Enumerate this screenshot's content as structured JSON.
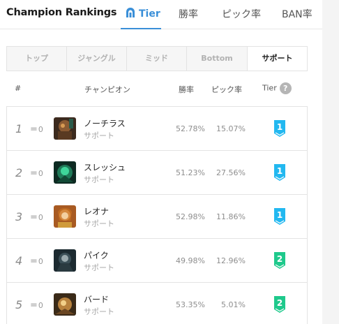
{
  "header": {
    "title": "Champion Rankings",
    "tabs": [
      {
        "label": "Tier",
        "active": true
      },
      {
        "label": "勝率",
        "active": false
      },
      {
        "label": "ピック率",
        "active": false
      },
      {
        "label": "BAN率",
        "active": false
      }
    ],
    "accent_color": "#3a8fd8"
  },
  "role_tabs": [
    "トップ",
    "ジャングル",
    "ミッド",
    "Bottom",
    "サポート"
  ],
  "active_role_index": 4,
  "columns": {
    "rank": "#",
    "champion": "チャンピオン",
    "win_rate": "勝率",
    "pick_rate": "ピック率",
    "tier": "Tier",
    "help": "?"
  },
  "rows": [
    {
      "rank": "1",
      "change": "0",
      "name": "ノーチラス",
      "role": "サポート",
      "win_rate": "52.78%",
      "pick_rate": "15.07%",
      "tier": "1",
      "tier_color": "#22b8f0"
    },
    {
      "rank": "2",
      "change": "0",
      "name": "スレッシュ",
      "role": "サポート",
      "win_rate": "51.23%",
      "pick_rate": "27.56%",
      "tier": "1",
      "tier_color": "#22b8f0"
    },
    {
      "rank": "3",
      "change": "0",
      "name": "レオナ",
      "role": "サポート",
      "win_rate": "52.98%",
      "pick_rate": "11.86%",
      "tier": "1",
      "tier_color": "#22b8f0"
    },
    {
      "rank": "4",
      "change": "0",
      "name": "パイク",
      "role": "サポート",
      "win_rate": "49.98%",
      "pick_rate": "12.96%",
      "tier": "2",
      "tier_color": "#1fc98c"
    },
    {
      "rank": "5",
      "change": "0",
      "name": "バード",
      "role": "サポート",
      "win_rate": "53.35%",
      "pick_rate": "5.01%",
      "tier": "2",
      "tier_color": "#1fc98c"
    }
  ]
}
